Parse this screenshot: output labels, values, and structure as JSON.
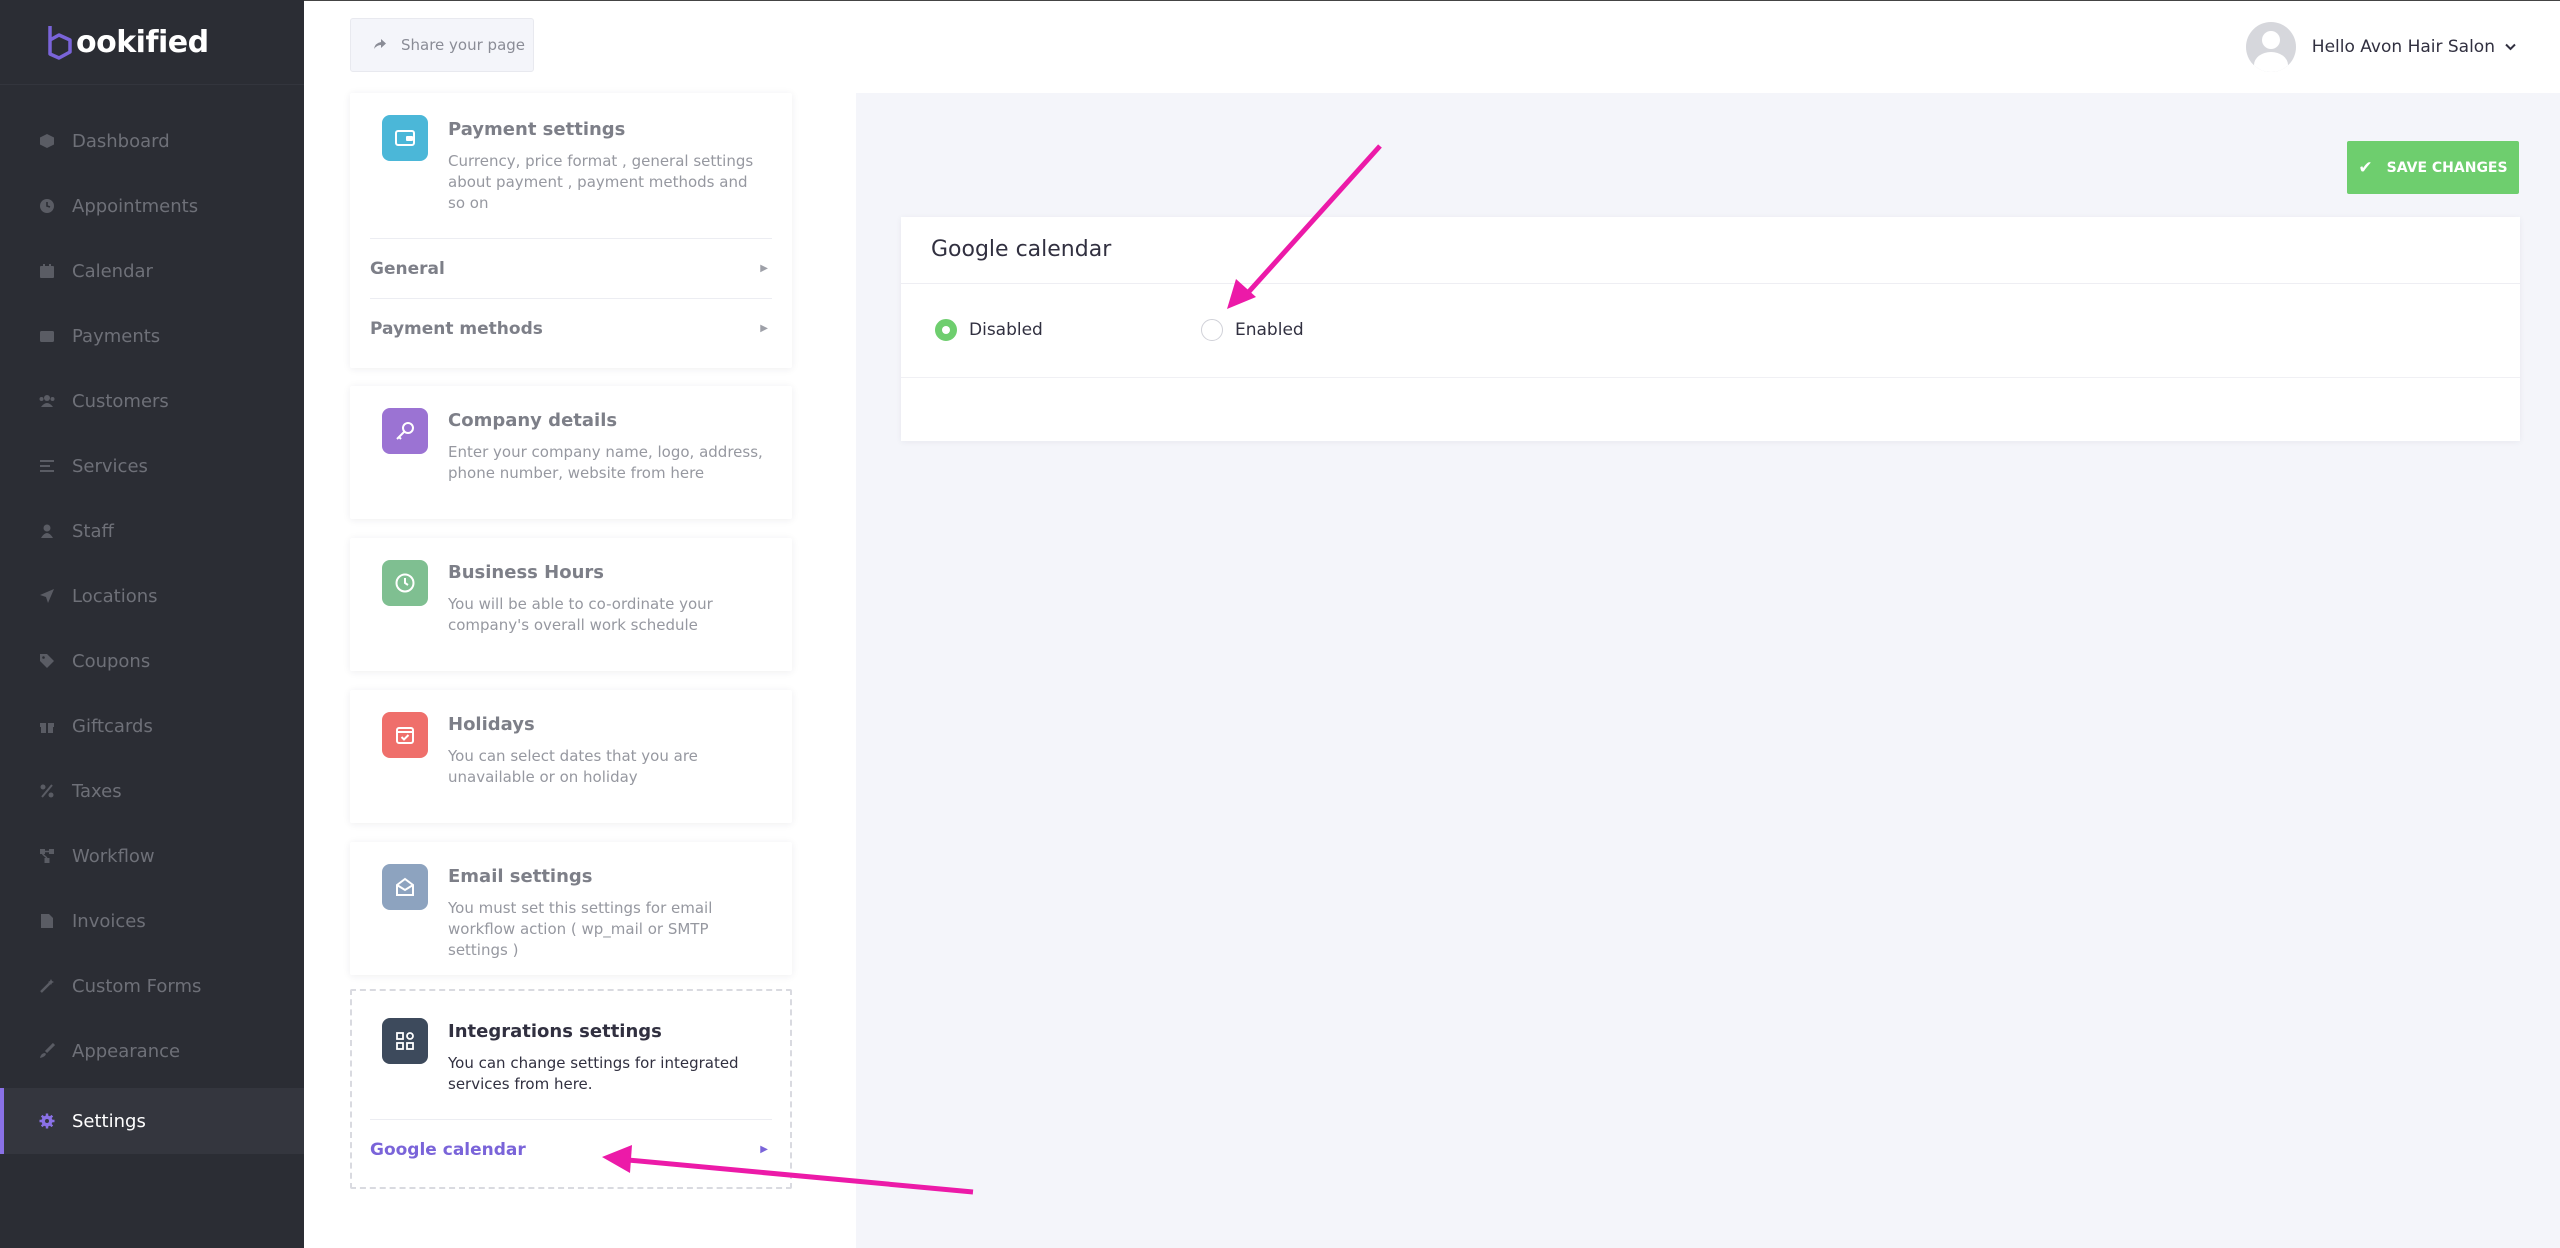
{
  "brand": {
    "name": "ookified",
    "mark": "b"
  },
  "sidebar": {
    "items": [
      {
        "label": "Dashboard",
        "icon": "cube-icon"
      },
      {
        "label": "Appointments",
        "icon": "clock-icon"
      },
      {
        "label": "Calendar",
        "icon": "calendar-icon"
      },
      {
        "label": "Payments",
        "icon": "wallet-icon"
      },
      {
        "label": "Customers",
        "icon": "users-icon"
      },
      {
        "label": "Services",
        "icon": "list-icon"
      },
      {
        "label": "Staff",
        "icon": "user-icon"
      },
      {
        "label": "Locations",
        "icon": "location-arrow-icon"
      },
      {
        "label": "Coupons",
        "icon": "tag-icon"
      },
      {
        "label": "Giftcards",
        "icon": "gift-icon"
      },
      {
        "label": "Taxes",
        "icon": "percent-icon"
      },
      {
        "label": "Workflow",
        "icon": "workflow-icon"
      },
      {
        "label": "Invoices",
        "icon": "file-icon"
      },
      {
        "label": "Custom Forms",
        "icon": "magic-wand-icon"
      },
      {
        "label": "Appearance",
        "icon": "brush-icon"
      },
      {
        "label": "Settings",
        "icon": "gear-icon",
        "active": true
      }
    ]
  },
  "header": {
    "share_label": "Share your page",
    "greeting": "Hello Avon Hair Salon"
  },
  "settings": {
    "payment": {
      "title": "Payment settings",
      "desc": "Currency, price format , general settings about payment , payment methods and so on",
      "sub": [
        "General",
        "Payment methods"
      ]
    },
    "company": {
      "title": "Company details",
      "desc": "Enter your company name, logo, address, phone number, website from here"
    },
    "hours": {
      "title": "Business Hours",
      "desc": "You will be able to co-ordinate your company's overall work schedule"
    },
    "holidays": {
      "title": "Holidays",
      "desc": "You can select dates that you are unavailable or on holiday"
    },
    "email": {
      "title": "Email settings",
      "desc": "You must set this settings for email workflow action ( wp_mail or SMTP settings )"
    },
    "integrations": {
      "title": "Integrations settings",
      "desc": "You can change settings for integrated services from here.",
      "sub": [
        "Google calendar"
      ]
    }
  },
  "main": {
    "save_label": "SAVE CHANGES",
    "panel_title": "Google calendar",
    "options": [
      {
        "label": "Disabled",
        "checked": true
      },
      {
        "label": "Enabled",
        "checked": false
      }
    ]
  },
  "colors": {
    "accent": "#7a64d9",
    "save_green": "#6ece6e",
    "annotation": "#ec1aa8",
    "sidebar_bg": "#2b2d34"
  }
}
